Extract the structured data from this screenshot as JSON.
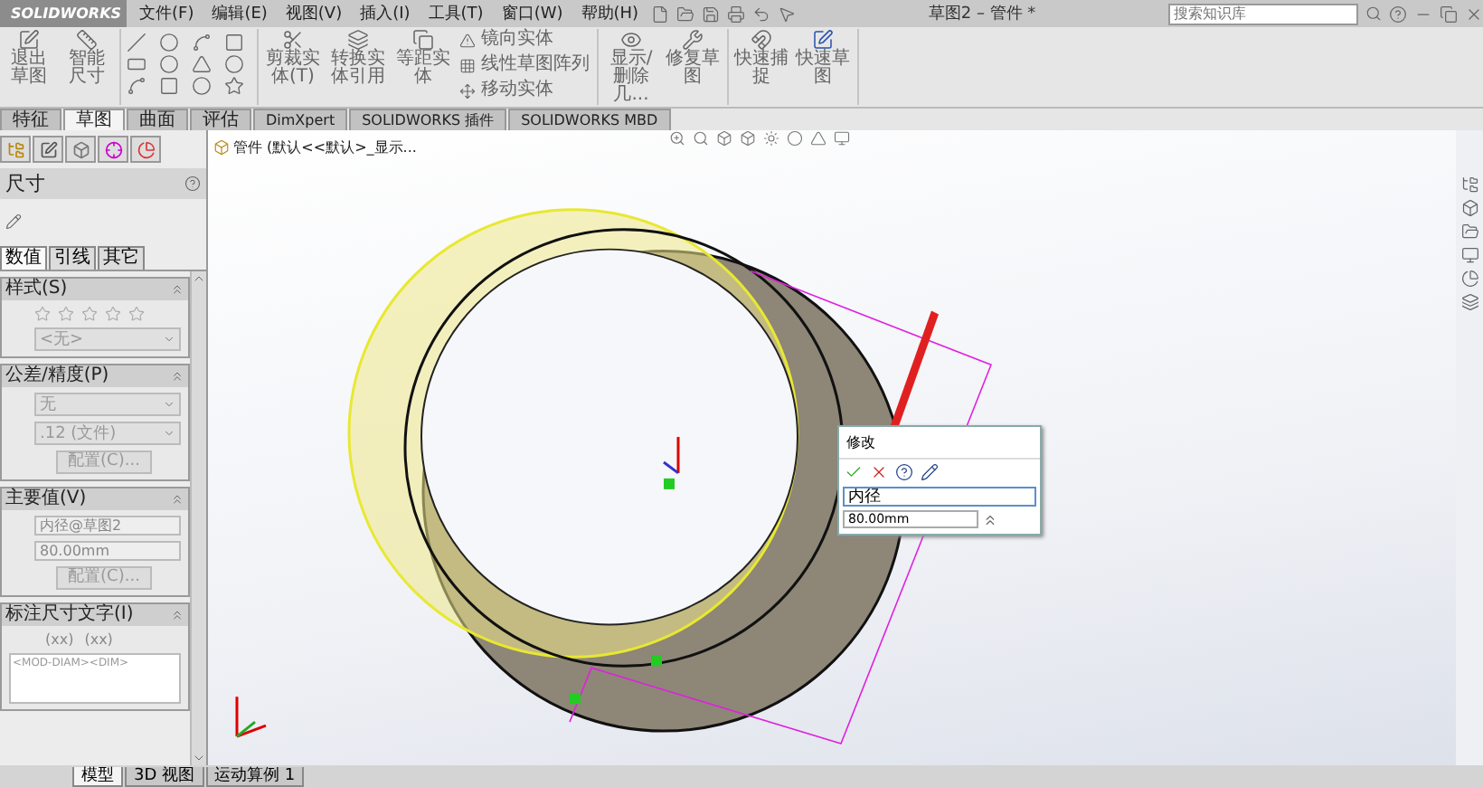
{
  "app": {
    "logo": "SOLIDWORKS",
    "title": "草图2 – 管件 *",
    "search_placeholder": "搜索知识库"
  },
  "menu": [
    "文件(F)",
    "编辑(E)",
    "视图(V)",
    "插入(I)",
    "工具(T)",
    "窗口(W)",
    "帮助(H)"
  ],
  "ribbon": {
    "large_tools": [
      "退出草图",
      "智能尺寸"
    ],
    "mid_tools": [
      "剪裁实体(T)",
      "转换实体引用",
      "等距实体"
    ],
    "list_tools": [
      "镜向实体",
      "线性草图阵列",
      "移动实体"
    ],
    "right_tools": [
      "显示/删除几...",
      "修复草图"
    ],
    "quick_tools": [
      "快速捕捉",
      "快速草图"
    ]
  },
  "command_tabs": [
    {
      "label": "特征",
      "selected": false
    },
    {
      "label": "草图",
      "selected": true
    },
    {
      "label": "曲面",
      "selected": false
    },
    {
      "label": "评估",
      "selected": false
    },
    {
      "label": "DimXpert",
      "selected": false
    },
    {
      "label": "SOLIDWORKS 插件",
      "selected": false
    },
    {
      "label": "SOLIDWORKS MBD",
      "selected": false
    }
  ],
  "feature_tree": {
    "root": "管件 (默认<<默认>_显示..."
  },
  "property_manager": {
    "title": "尺寸",
    "tabs": [
      {
        "label": "数值",
        "selected": true
      },
      {
        "label": "引线",
        "selected": false
      },
      {
        "label": "其它",
        "selected": false
      }
    ],
    "sections": [
      {
        "kind": "style",
        "title": "样式(S)",
        "select": "<无>"
      },
      {
        "kind": "tolerance",
        "title": "公差/精度(P)",
        "tolerance": "无",
        "precision": ".12 (文件)",
        "button": "配置(C)..."
      },
      {
        "kind": "primary",
        "title": "主要值(V)",
        "name": "内径@草图2",
        "value": "80.00mm",
        "button": "配置(C)..."
      },
      {
        "kind": "text",
        "title": "标注尺寸文字(I)",
        "symbols": [
          "(xx)",
          "(xx)"
        ],
        "text": "<MOD-DIAM><DIM>"
      }
    ]
  },
  "modify_dialog": {
    "title": "修改",
    "name": "内径",
    "value": "80.00mm"
  },
  "bottom_tabs": [
    {
      "label": "模型",
      "selected": true
    },
    {
      "label": "3D 视图",
      "selected": false
    },
    {
      "label": "运动算例 1",
      "selected": false
    }
  ]
}
